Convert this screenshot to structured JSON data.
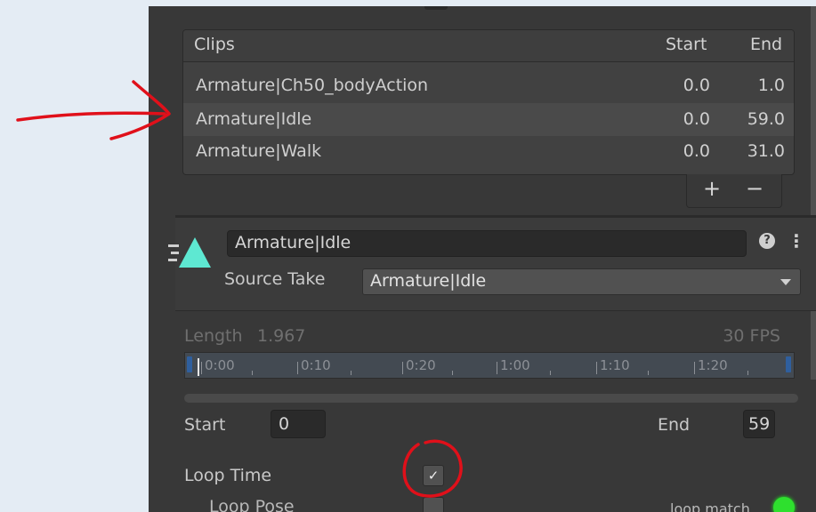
{
  "clips_panel": {
    "headers": {
      "clips": "Clips",
      "start": "Start",
      "end": "End"
    },
    "rows": [
      {
        "name": "Armature|Ch50_bodyAction",
        "start": "0.0",
        "end": "1.0"
      },
      {
        "name": "Armature|Idle",
        "start": "0.0",
        "end": "59.0"
      },
      {
        "name": "Armature|Walk",
        "start": "0.0",
        "end": "31.0"
      }
    ],
    "selected_index": 1,
    "add_label": "+",
    "remove_label": "−"
  },
  "clip_settings": {
    "name_value": "Armature|Idle",
    "help_icon": "?",
    "menu_icon": "⋮",
    "source_take_label": "Source Take",
    "source_take_value": "Armature|Idle",
    "length_label": "Length",
    "length_value": "1.967",
    "fps_text": "30 FPS",
    "timeline_labels": [
      "0:00",
      "0:10",
      "0:20",
      "1:00",
      "1:10",
      "1:20"
    ],
    "start_label": "Start",
    "start_value": "0",
    "end_label": "End",
    "end_value": "59",
    "loop_time_label": "Loop Time",
    "loop_time_checked": true,
    "loop_pose_label": "Loop Pose",
    "loop_match_label": "loop match"
  },
  "colors": {
    "panel_bg": "#383838",
    "annotation_red": "#e0101a",
    "loop_match_green": "#2ee02e",
    "icon_teal": "#5ee8d2"
  }
}
